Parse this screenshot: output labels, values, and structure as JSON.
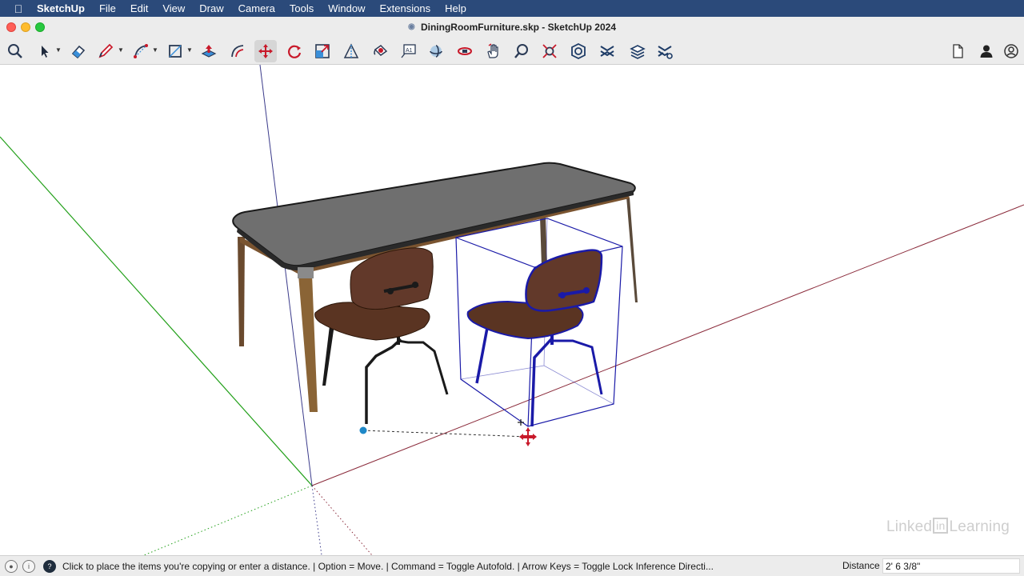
{
  "menubar": {
    "app_name": "SketchUp",
    "items": [
      "File",
      "Edit",
      "View",
      "Draw",
      "Camera",
      "Tools",
      "Window",
      "Extensions",
      "Help"
    ]
  },
  "window": {
    "title": "DiningRoomFurniture.skp - SketchUp 2024"
  },
  "toolbar": {
    "tools": [
      {
        "name": "search-icon"
      },
      {
        "name": "select-tool-icon"
      },
      {
        "name": "eraser-tool-icon"
      },
      {
        "name": "pencil-line-tool-icon"
      },
      {
        "name": "arc-tool-icon"
      },
      {
        "name": "rectangle-tool-icon"
      },
      {
        "name": "push-pull-tool-icon"
      },
      {
        "name": "offset-tool-icon"
      },
      {
        "name": "move-tool-icon",
        "active": true
      },
      {
        "name": "rotate-tool-icon"
      },
      {
        "name": "scale-tool-icon"
      },
      {
        "name": "protractor-tool-icon"
      },
      {
        "name": "paint-bucket-tool-icon"
      },
      {
        "name": "text-tool-icon"
      },
      {
        "name": "orbit-tool-icon"
      },
      {
        "name": "pan-tool-icon"
      },
      {
        "name": "hand-tool-icon"
      },
      {
        "name": "zoom-tool-icon"
      },
      {
        "name": "zoom-extents-tool-icon"
      },
      {
        "name": "3d-warehouse-icon"
      },
      {
        "name": "extension-warehouse-icon"
      },
      {
        "name": "layout-send-icon"
      },
      {
        "name": "extension-manager-icon"
      }
    ],
    "right": [
      {
        "name": "document-icon"
      },
      {
        "name": "user-account-icon"
      },
      {
        "name": "profile-icon"
      }
    ]
  },
  "viewport": {
    "axes_colors": {
      "red": "#8a2a3a",
      "green": "#23a01a",
      "blue": "#3a3a8a"
    },
    "selection_color": "#1a1aa8",
    "model": [
      "dining-table",
      "chair",
      "chair-copy"
    ]
  },
  "status": {
    "message": "Click to place the items you're copying or enter a distance. | Option = Move. | Command = Toggle Autofold. | Arrow Keys = Toggle Lock Inference Directi...",
    "measure_label": "Distance",
    "measure_value": "2' 6 3/8\"",
    "watermark_a": "Linked",
    "watermark_b": "in",
    "watermark_c": "Learning"
  }
}
